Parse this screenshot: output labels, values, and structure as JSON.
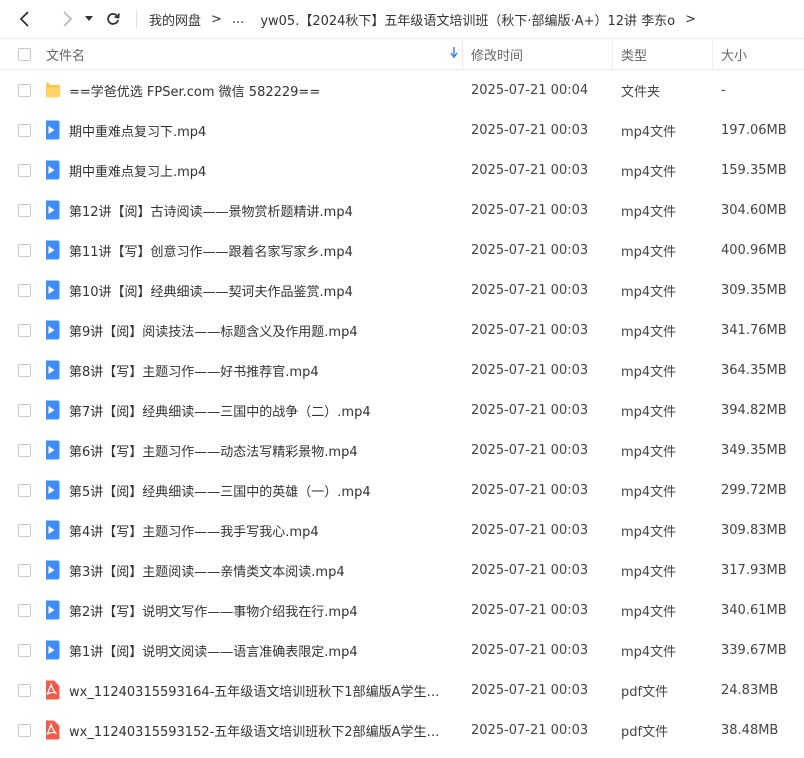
{
  "toolbar": {
    "breadcrumbs": [
      "我的网盘",
      "...",
      "yw05.【2024秋下】五年级语文培训班（秋下·部编版·A+）12讲 李东o"
    ],
    "separator": ">"
  },
  "table": {
    "columns": {
      "name": "文件名",
      "time": "修改时间",
      "type": "类型",
      "size": "大小"
    },
    "rows": [
      {
        "icon": "folder",
        "name": "==学爸优选 FPSer.com 微信 582229==",
        "time": "2025-07-21 00:04",
        "type": "文件夹",
        "size": "-"
      },
      {
        "icon": "video",
        "name": "期中重难点复习下.mp4",
        "time": "2025-07-21 00:03",
        "type": "mp4文件",
        "size": "197.06MB"
      },
      {
        "icon": "video",
        "name": "期中重难点复习上.mp4",
        "time": "2025-07-21 00:03",
        "type": "mp4文件",
        "size": "159.35MB"
      },
      {
        "icon": "video",
        "name": "第12讲【阅】古诗阅读——景物赏析题精讲.mp4",
        "time": "2025-07-21 00:03",
        "type": "mp4文件",
        "size": "304.60MB"
      },
      {
        "icon": "video",
        "name": "第11讲【写】创意习作——跟着名家写家乡.mp4",
        "time": "2025-07-21 00:03",
        "type": "mp4文件",
        "size": "400.96MB"
      },
      {
        "icon": "video",
        "name": "第10讲【阅】经典细读——契诃夫作品鉴赏.mp4",
        "time": "2025-07-21 00:03",
        "type": "mp4文件",
        "size": "309.35MB"
      },
      {
        "icon": "video",
        "name": "第9讲【阅】阅读技法——标题含义及作用题.mp4",
        "time": "2025-07-21 00:03",
        "type": "mp4文件",
        "size": "341.76MB"
      },
      {
        "icon": "video",
        "name": "第8讲【写】主题习作——好书推荐官.mp4",
        "time": "2025-07-21 00:03",
        "type": "mp4文件",
        "size": "364.35MB"
      },
      {
        "icon": "video",
        "name": "第7讲【阅】经典细读——三国中的战争（二）.mp4",
        "time": "2025-07-21 00:03",
        "type": "mp4文件",
        "size": "394.82MB"
      },
      {
        "icon": "video",
        "name": "第6讲【写】主题习作——动态法写精彩景物.mp4",
        "time": "2025-07-21 00:03",
        "type": "mp4文件",
        "size": "349.35MB"
      },
      {
        "icon": "video",
        "name": "第5讲【阅】经典细读——三国中的英雄（一）.mp4",
        "time": "2025-07-21 00:03",
        "type": "mp4文件",
        "size": "299.72MB"
      },
      {
        "icon": "video",
        "name": "第4讲【写】主题习作——我手写我心.mp4",
        "time": "2025-07-21 00:03",
        "type": "mp4文件",
        "size": "309.83MB"
      },
      {
        "icon": "video",
        "name": "第3讲【阅】主题阅读——亲情类文本阅读.mp4",
        "time": "2025-07-21 00:03",
        "type": "mp4文件",
        "size": "317.93MB"
      },
      {
        "icon": "video",
        "name": "第2讲【写】说明文写作——事物介绍我在行.mp4",
        "time": "2025-07-21 00:03",
        "type": "mp4文件",
        "size": "340.61MB"
      },
      {
        "icon": "video",
        "name": "第1讲【阅】说明文阅读——语言准确表限定.mp4",
        "time": "2025-07-21 00:03",
        "type": "mp4文件",
        "size": "339.67MB"
      },
      {
        "icon": "pdf",
        "name": "wx_11240315593164-五年级语文培训班秋下1部编版A学生用书爱豆...",
        "time": "2025-07-21 00:03",
        "type": "pdf文件",
        "size": "24.83MB"
      },
      {
        "icon": "pdf",
        "name": "wx_11240315593152-五年级语文培训班秋下2部编版A学生用书爱豆...",
        "time": "2025-07-21 00:03",
        "type": "pdf文件",
        "size": "38.48MB"
      }
    ]
  },
  "colors": {
    "accent": "#2e78ff",
    "folder": "#ffc53d",
    "video": "#3f8cff",
    "pdf": "#f25a4a"
  }
}
